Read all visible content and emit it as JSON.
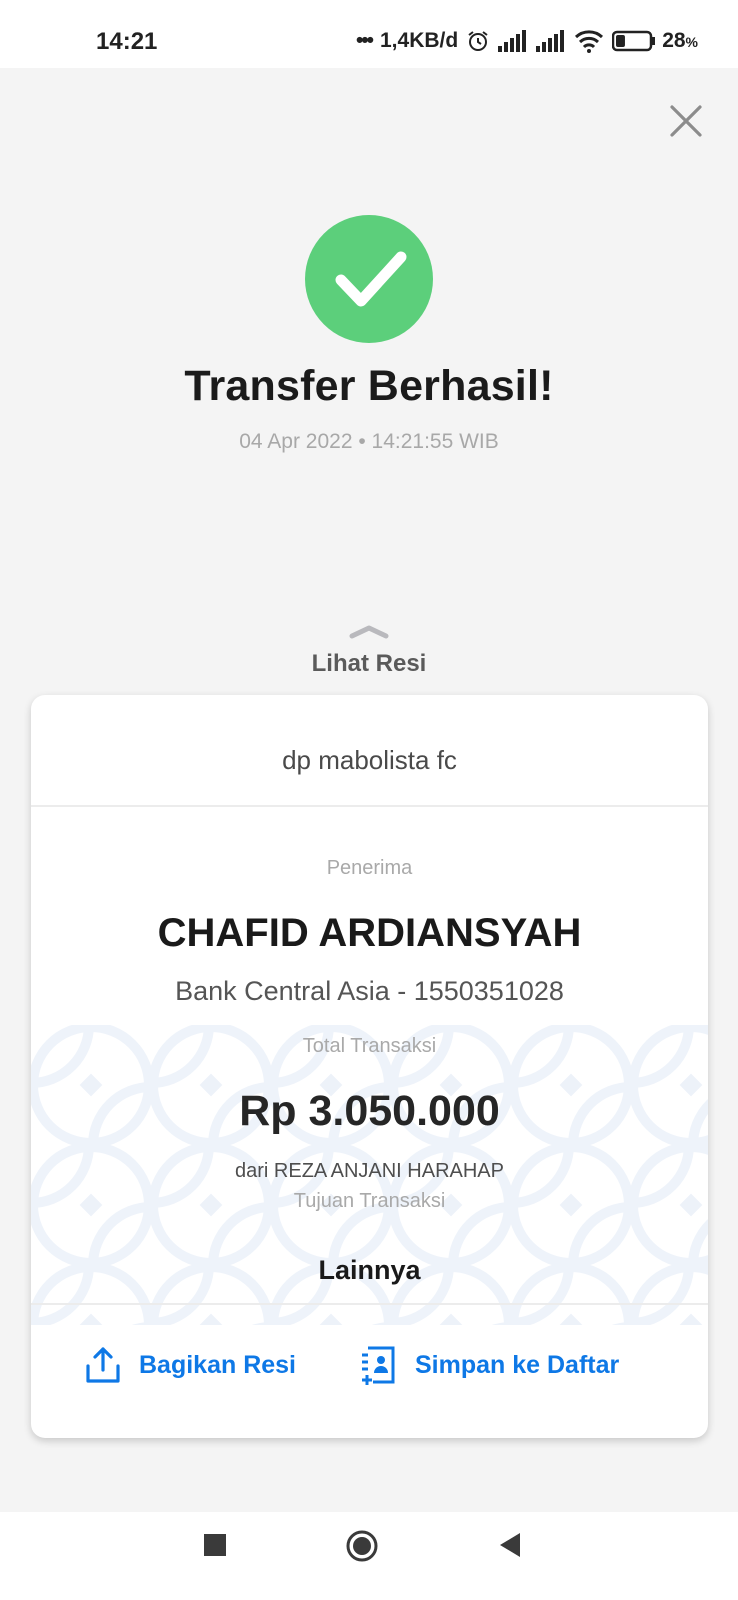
{
  "status_bar": {
    "time": "14:21",
    "dots": "•••",
    "network_speed": "1,4KB/d",
    "battery_percent": "28",
    "battery_unit": "%",
    "battery_level": 0.28
  },
  "header": {
    "close_icon": "close-icon"
  },
  "result": {
    "icon": "checkmark-icon",
    "title": "Transfer Berhasil!",
    "datetime": "04 Apr 2022 • 14:21:55 WIB",
    "colors": {
      "success": "#5ccf7b"
    }
  },
  "receipt_toggle": {
    "label": "Lihat Resi",
    "icon": "chevron-up-icon"
  },
  "receipt": {
    "note": "dp mabolista fc",
    "recipient_label": "Penerima",
    "recipient_name": "CHAFID ARDIANSYAH",
    "recipient_bank": "Bank Central Asia - 1550351028",
    "total_label": "Total Transaksi",
    "total_amount": "Rp 3.050.000",
    "from": "dari REZA ANJANI HARAHAP",
    "purpose_label": "Tujuan Transaksi",
    "purpose_value": "Lainnya"
  },
  "actions": {
    "share_label": "Bagikan Resi",
    "share_icon": "share-icon",
    "save_label": "Simpan ke Daftar",
    "save_icon": "add-contact-icon",
    "accent": "#0e78e6"
  },
  "nav_bar": {
    "recents_icon": "square-icon",
    "home_icon": "circle-icon",
    "back_icon": "back-triangle-icon"
  }
}
